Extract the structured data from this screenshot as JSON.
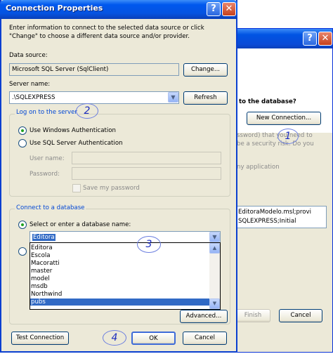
{
  "background_window": {
    "heading": "to the database?",
    "new_connection_label": "New Connection...",
    "text_line1": "ssword) that you need to",
    "text_line2": "be a security risk. Do you",
    "text_line3": "ny application",
    "conn_line1": "EditoraModelo.msl;provi",
    "conn_line2": "SQLEXPRESS;Initial",
    "finish_label": "Finish",
    "cancel_label": "Cancel",
    "help_glyph": "?",
    "close_glyph": "✕"
  },
  "dialog": {
    "title": "Connection Properties",
    "help_glyph": "?",
    "close_glyph": "✕",
    "intro_line1": "Enter information to connect to the selected data source or click",
    "intro_line2": "\"Change\" to choose a different data source and/or provider.",
    "data_source_label": "Data source:",
    "data_source_value": "Microsoft SQL Server (SqlClient)",
    "change_label": "Change...",
    "server_name_label": "Server name:",
    "server_name_value": ".\\SQLEXPRESS",
    "refresh_label": "Refresh",
    "logon_group_title": "Log on to the server",
    "windows_auth_label": "Use Windows Authentication",
    "sql_auth_label": "Use SQL Server Authentication",
    "user_name_label": "User name:",
    "password_label": "Password:",
    "save_password_label": "Save my password",
    "connect_group_title": "Connect to a database",
    "select_db_label": "Select or enter a database name:",
    "db_value": "Editora",
    "db_options": [
      "Editora",
      "Escola",
      "Macoratti",
      "master",
      "model",
      "msdb",
      "Northwind",
      "pubs"
    ],
    "selected_index": 7,
    "advanced_label": "Advanced...",
    "test_connection_label": "Test Connection",
    "ok_label": "OK",
    "cancel_label": "Cancel"
  },
  "annotations": [
    "1",
    "2",
    "3",
    "4"
  ],
  "colors": {
    "title_bar": "#0054e3",
    "dialog_face": "#ece9d8",
    "group_title": "#0046d5",
    "selection": "#316ac5",
    "annotation": "#1b2cbf"
  }
}
